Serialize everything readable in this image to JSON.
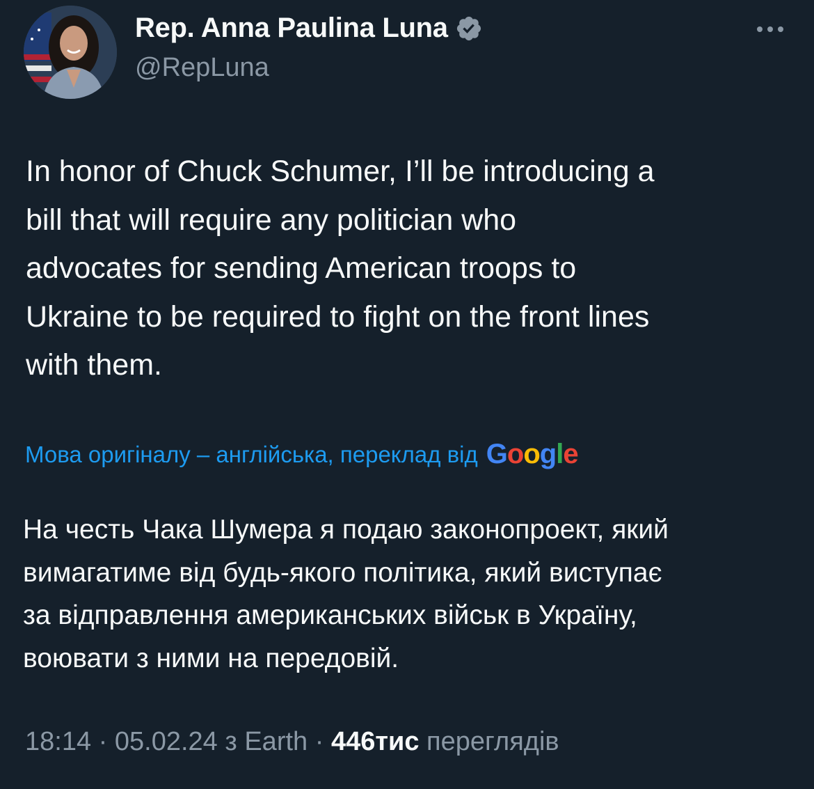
{
  "author": {
    "display_name": "Rep. Anna Paulina Luna",
    "handle": "@RepLuna",
    "verified_color": "#8b98a5"
  },
  "more_icon": "more-horizontal-icon",
  "tweet": {
    "text": "In honor of Chuck Schumer, I’ll be introducing a\nbill that will require any politician who\nadvocates for sending American troops to\nUkraine to be required to fight on the front lines\nwith them."
  },
  "translation": {
    "label": "Мова оригіналу – англійська, переклад від",
    "provider": "Google",
    "provider_colors": [
      "#4285f4",
      "#ea4335",
      "#fbbc05",
      "#4285f4",
      "#34a853",
      "#ea4335"
    ],
    "text": "На честь Чака Шумера я подаю законопроект, який\nвимагатиме від будь-якого політика, який виступає\nза відправлення американських військ в Україну,\nвоювати з ними на передовій."
  },
  "meta": {
    "time": "18:14",
    "date": "05.02.24",
    "source": "з Earth",
    "views_count": "446тис",
    "views_label": "переглядів"
  },
  "colors": {
    "background": "#15202b",
    "accent": "#1d9bf0",
    "secondary_text": "#8b98a5"
  }
}
